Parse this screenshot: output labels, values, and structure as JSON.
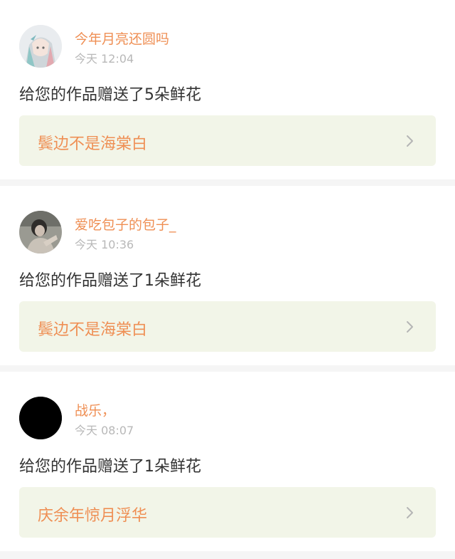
{
  "notifications": [
    {
      "username": "今年月亮还圆吗",
      "time": "今天 12:04",
      "message": "给您的作品赠送了5朵鲜花",
      "work_title": "鬓边不是海棠白",
      "avatar_icon": "anime-girl-avatar"
    },
    {
      "username": "爱吃包子的包子_",
      "time": "今天 10:36",
      "message": "给您的作品赠送了1朵鲜花",
      "work_title": "鬓边不是海棠白",
      "avatar_icon": "photo-portrait-avatar"
    },
    {
      "username": "战乐，",
      "time": "今天 08:07",
      "message": "给您的作品赠送了1朵鲜花",
      "work_title": "庆余年惊月浮华",
      "avatar_icon": "black-circle-avatar"
    }
  ],
  "colors": {
    "accent": "#ef8f54",
    "link_bg": "#f2f5e8",
    "time": "#b8b8b8",
    "text": "#333333",
    "separator": "#f5f5f5"
  }
}
